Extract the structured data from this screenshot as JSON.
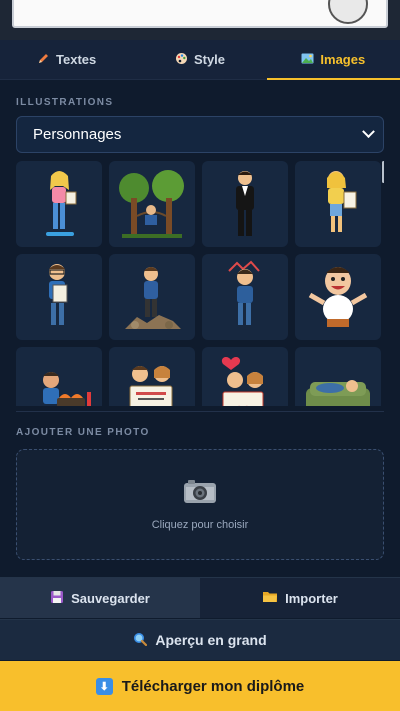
{
  "tabs": [
    {
      "label": "Textes",
      "icon": "pencil-icon"
    },
    {
      "label": "Style",
      "icon": "palette-icon"
    },
    {
      "label": "Images",
      "icon": "picture-icon",
      "active": true
    }
  ],
  "illustrations": {
    "title": "ILLUSTRATIONS",
    "category_selected": "Personnages",
    "items": [
      {
        "name": "woman-with-scroll"
      },
      {
        "name": "man-between-trees"
      },
      {
        "name": "man-in-tuxedo"
      },
      {
        "name": "blonde-with-diploma"
      },
      {
        "name": "nerd-with-certificate"
      },
      {
        "name": "man-on-rubble"
      },
      {
        "name": "stressed-man"
      },
      {
        "name": "happy-cartoon-man"
      },
      {
        "name": "cook-at-grill"
      },
      {
        "name": "couple-with-sign"
      },
      {
        "name": "couple-je-taime"
      },
      {
        "name": "man-on-sofa"
      }
    ]
  },
  "photo": {
    "title": "AJOUTER UNE PHOTO",
    "hint": "Cliquez pour choisir"
  },
  "actions": {
    "save_label": "Sauvegarder",
    "import_label": "Importer"
  },
  "preview_label": "Aperçu en grand",
  "download_label": "Télécharger mon diplôme",
  "colors": {
    "accent": "#f6c02c",
    "background": "#0f1b2d",
    "download_bg": "#f8bf2c"
  }
}
